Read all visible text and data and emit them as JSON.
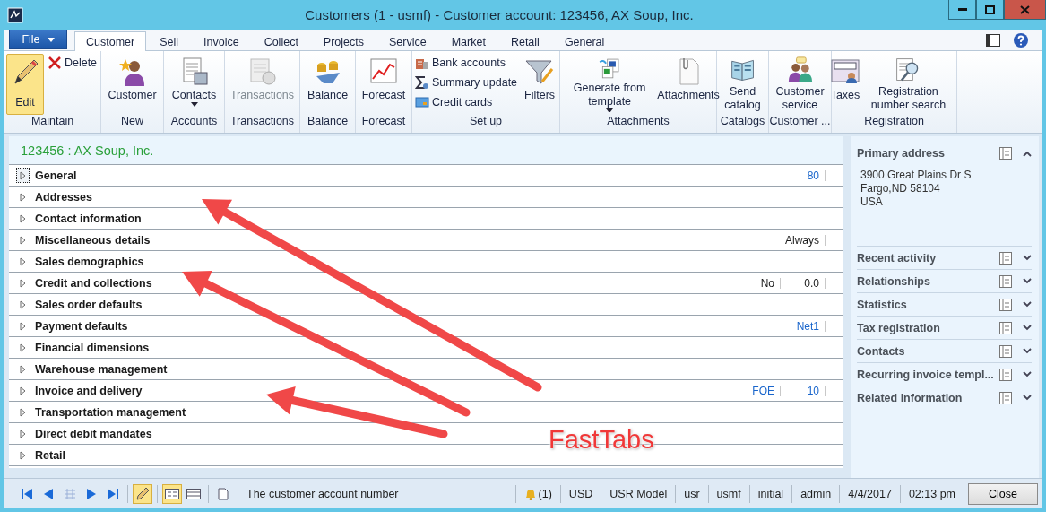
{
  "window": {
    "title": "Customers (1 - usmf) - Customer account: 123456, AX Soup, Inc."
  },
  "tabs": [
    {
      "label": "File",
      "kind": "file",
      "selected": false
    },
    {
      "label": "Customer",
      "kind": "tab",
      "selected": true
    },
    {
      "label": "Sell",
      "kind": "tab",
      "selected": false
    },
    {
      "label": "Invoice",
      "kind": "tab",
      "selected": false
    },
    {
      "label": "Collect",
      "kind": "tab",
      "selected": false
    },
    {
      "label": "Projects",
      "kind": "tab",
      "selected": false
    },
    {
      "label": "Service",
      "kind": "tab",
      "selected": false
    },
    {
      "label": "Market",
      "kind": "tab",
      "selected": false
    },
    {
      "label": "Retail",
      "kind": "tab",
      "selected": false
    },
    {
      "label": "General",
      "kind": "tab",
      "selected": false
    }
  ],
  "ribbon": [
    {
      "label": "Maintain",
      "buttons": [
        {
          "label": "Edit",
          "kind": "large",
          "selected": true,
          "disabled": false,
          "dropdown": false
        },
        {
          "label": "Delete",
          "kind": "small",
          "disabled": false
        }
      ]
    },
    {
      "label": "New",
      "buttons": [
        {
          "label": "Customer",
          "kind": "large",
          "selected": false,
          "disabled": false,
          "dropdown": false
        }
      ]
    },
    {
      "label": "Accounts",
      "buttons": [
        {
          "label": "Contacts",
          "kind": "large",
          "selected": false,
          "disabled": false,
          "dropdown": true
        }
      ]
    },
    {
      "label": "Transactions",
      "buttons": [
        {
          "label": "Transactions",
          "kind": "large",
          "selected": false,
          "disabled": true,
          "dropdown": false
        }
      ]
    },
    {
      "label": "Balance",
      "buttons": [
        {
          "label": "Balance",
          "kind": "large",
          "selected": false,
          "disabled": false,
          "dropdown": false
        }
      ]
    },
    {
      "label": "Forecast",
      "buttons": [
        {
          "label": "Forecast",
          "kind": "large",
          "selected": false,
          "disabled": false,
          "dropdown": false
        }
      ]
    },
    {
      "label": "Set up",
      "buttons": [
        {
          "label": "Bank accounts",
          "kind": "small",
          "disabled": false
        },
        {
          "label": "Summary update",
          "kind": "small",
          "disabled": false
        },
        {
          "label": "Credit cards",
          "kind": "small",
          "disabled": false
        },
        {
          "label": "Filters",
          "kind": "large",
          "selected": false,
          "disabled": false,
          "dropdown": false
        }
      ]
    },
    {
      "label": "Attachments",
      "buttons": [
        {
          "label": "Generate from template",
          "kind": "large",
          "selected": false,
          "disabled": false,
          "dropdown": true
        },
        {
          "label": "Attachments",
          "kind": "large",
          "selected": false,
          "disabled": false,
          "dropdown": false
        }
      ]
    },
    {
      "label": "Catalogs",
      "buttons": [
        {
          "label": "Send catalog",
          "kind": "large",
          "selected": false,
          "disabled": false,
          "dropdown": false
        }
      ]
    },
    {
      "label": "Customer ...",
      "buttons": [
        {
          "label": "Customer service",
          "kind": "large",
          "selected": false,
          "disabled": false,
          "dropdown": false
        }
      ]
    },
    {
      "label": "Registration",
      "buttons": [
        {
          "label": "Taxes",
          "kind": "large",
          "selected": false,
          "disabled": false,
          "dropdown": false
        },
        {
          "label": "Registration number search",
          "kind": "large",
          "selected": false,
          "disabled": false,
          "dropdown": false
        }
      ]
    }
  ],
  "record_title": "123456 : AX Soup, Inc.",
  "fasttabs": [
    {
      "label": "General",
      "selected": true,
      "summary": [
        {
          "text": "80",
          "kind": "link"
        }
      ]
    },
    {
      "label": "Addresses",
      "selected": false
    },
    {
      "label": "Contact information",
      "selected": false
    },
    {
      "label": "Miscellaneous details",
      "selected": false,
      "summary": [
        {
          "text": "Always",
          "kind": "plain"
        }
      ]
    },
    {
      "label": "Sales demographics",
      "selected": false
    },
    {
      "label": "Credit and collections",
      "selected": false,
      "summary": [
        {
          "text": "No",
          "kind": "plain"
        },
        {
          "text": "0.0",
          "kind": "plain"
        }
      ]
    },
    {
      "label": "Sales order defaults",
      "selected": false
    },
    {
      "label": "Payment defaults",
      "selected": false,
      "summary": [
        {
          "text": "Net1",
          "kind": "link"
        }
      ]
    },
    {
      "label": "Financial dimensions",
      "selected": false
    },
    {
      "label": "Warehouse management",
      "selected": false
    },
    {
      "label": "Invoice and delivery",
      "selected": false,
      "summary": [
        {
          "text": "FOE",
          "kind": "link"
        },
        {
          "text": "10",
          "kind": "link"
        }
      ]
    },
    {
      "label": "Transportation management",
      "selected": false
    },
    {
      "label": "Direct debit mandates",
      "selected": false
    },
    {
      "label": "Retail",
      "selected": false
    }
  ],
  "factboxes": [
    {
      "title": "Primary address",
      "expanded": true,
      "lines": [
        "3900 Great Plains Dr S",
        "Fargo,ND 58104",
        "USA"
      ]
    },
    {
      "title": "Recent activity",
      "expanded": false
    },
    {
      "title": "Relationships",
      "expanded": false
    },
    {
      "title": "Statistics",
      "expanded": false
    },
    {
      "title": "Tax registration",
      "expanded": false
    },
    {
      "title": "Contacts",
      "expanded": false
    },
    {
      "title": "Recurring invoice templ...",
      "expanded": false
    },
    {
      "title": "Related information",
      "expanded": false
    }
  ],
  "status_bar": {
    "edit_mode": true,
    "view_buttons": [
      {
        "selected": true
      },
      {
        "selected": false
      }
    ],
    "message": "The customer account number",
    "notifications": "(1)",
    "cells": [
      "USD",
      "USR Model",
      "usr",
      "usmf",
      "initial",
      "admin",
      "4/4/2017",
      "02:13 pm"
    ],
    "close_button": "Close"
  },
  "annotation": {
    "label": "FastTabs"
  }
}
